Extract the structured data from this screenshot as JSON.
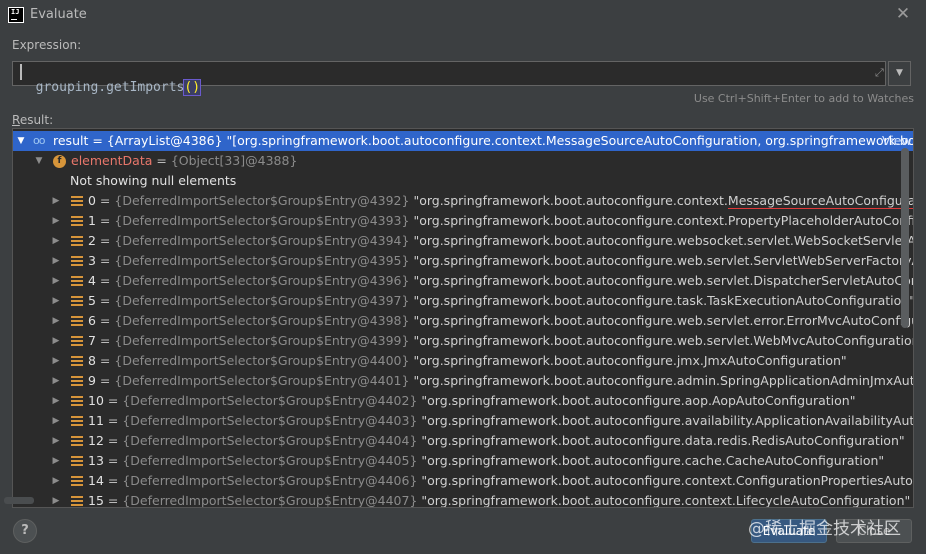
{
  "window": {
    "title": "Evaluate",
    "icon_label": "IJ"
  },
  "expression": {
    "label": "Expression:",
    "value_prefix": "grouping.getImports",
    "value_parens": "()",
    "hint": "Use Ctrl+Shift+Enter to add to Watches"
  },
  "result": {
    "label_first": "R",
    "label_rest": "esult:",
    "root": {
      "name": "result",
      "eq": " = ",
      "type": "{ArrayList@4386}",
      "value": " \"[org.springframework.boot.autoconfigure.context.MessageSourceAutoConfiguration, org.springframework.boot.a...",
      "view_link": "View"
    },
    "element_data": {
      "name": "elementData",
      "eq": " = ",
      "type": "{Object[33]@4388}"
    },
    "null_note": "Not showing null elements",
    "items": [
      {
        "index": "0",
        "type": "{DeferredImportSelector$Group$Entry@4392}",
        "prefix": "\"org.springframework.boot.autoconfigure.context.",
        "highlight": "MessageSourceAutoConfiguration",
        "suffix": "\""
      },
      {
        "index": "1",
        "type": "{DeferredImportSelector$Group$Entry@4393}",
        "value": "\"org.springframework.boot.autoconfigure.context.PropertyPlaceholderAutoConfiguration\""
      },
      {
        "index": "2",
        "type": "{DeferredImportSelector$Group$Entry@4394}",
        "value": "\"org.springframework.boot.autoconfigure.websocket.servlet.WebSocketServletAutoConfigu"
      },
      {
        "index": "3",
        "type": "{DeferredImportSelector$Group$Entry@4395}",
        "value": "\"org.springframework.boot.autoconfigure.web.servlet.ServletWebServerFactoryAutoConfigura"
      },
      {
        "index": "4",
        "type": "{DeferredImportSelector$Group$Entry@4396}",
        "value": "\"org.springframework.boot.autoconfigure.web.servlet.DispatcherServletAutoConfiguration\""
      },
      {
        "index": "5",
        "type": "{DeferredImportSelector$Group$Entry@4397}",
        "value": "\"org.springframework.boot.autoconfigure.task.TaskExecutionAutoConfiguration\""
      },
      {
        "index": "6",
        "type": "{DeferredImportSelector$Group$Entry@4398}",
        "value": "\"org.springframework.boot.autoconfigure.web.servlet.error.ErrorMvcAutoConfiguration\""
      },
      {
        "index": "7",
        "type": "{DeferredImportSelector$Group$Entry@4399}",
        "value": "\"org.springframework.boot.autoconfigure.web.servlet.WebMvcAutoConfiguration\""
      },
      {
        "index": "8",
        "type": "{DeferredImportSelector$Group$Entry@4400}",
        "value": "\"org.springframework.boot.autoconfigure.jmx.JmxAutoConfiguration\""
      },
      {
        "index": "9",
        "type": "{DeferredImportSelector$Group$Entry@4401}",
        "value": "\"org.springframework.boot.autoconfigure.admin.SpringApplicationAdminJmxAutoConfigura"
      },
      {
        "index": "10",
        "type": "{DeferredImportSelector$Group$Entry@4402}",
        "value": "\"org.springframework.boot.autoconfigure.aop.AopAutoConfiguration\""
      },
      {
        "index": "11",
        "type": "{DeferredImportSelector$Group$Entry@4403}",
        "value": "\"org.springframework.boot.autoconfigure.availability.ApplicationAvailabilityAutoConfigurat"
      },
      {
        "index": "12",
        "type": "{DeferredImportSelector$Group$Entry@4404}",
        "value": "\"org.springframework.boot.autoconfigure.data.redis.RedisAutoConfiguration\""
      },
      {
        "index": "13",
        "type": "{DeferredImportSelector$Group$Entry@4405}",
        "value": "\"org.springframework.boot.autoconfigure.cache.CacheAutoConfiguration\""
      },
      {
        "index": "14",
        "type": "{DeferredImportSelector$Group$Entry@4406}",
        "value": "\"org.springframework.boot.autoconfigure.context.ConfigurationPropertiesAutoConfigurati"
      },
      {
        "index": "15",
        "type": "{DeferredImportSelector$Group$Entry@4407}",
        "value": "\"org.springframework.boot.autoconfigure.context.LifecycleAutoConfiguration\""
      }
    ]
  },
  "buttons": {
    "help": "?",
    "evaluate": "Evaluate",
    "close": "Close"
  },
  "watermark": "@稀土掘金技术社区",
  "icons": {
    "close": "close-icon",
    "expand": "expand-icon",
    "dropdown": "chevron-down-icon",
    "watch": "watch-glasses-icon",
    "field": "field-icon",
    "entry": "list-entry-icon"
  },
  "colors": {
    "background": "#3c3f41",
    "tree_background": "#2b2b2b",
    "selection": "#2f65ca",
    "variable": "#e8776b",
    "accent_button": "#365880"
  }
}
